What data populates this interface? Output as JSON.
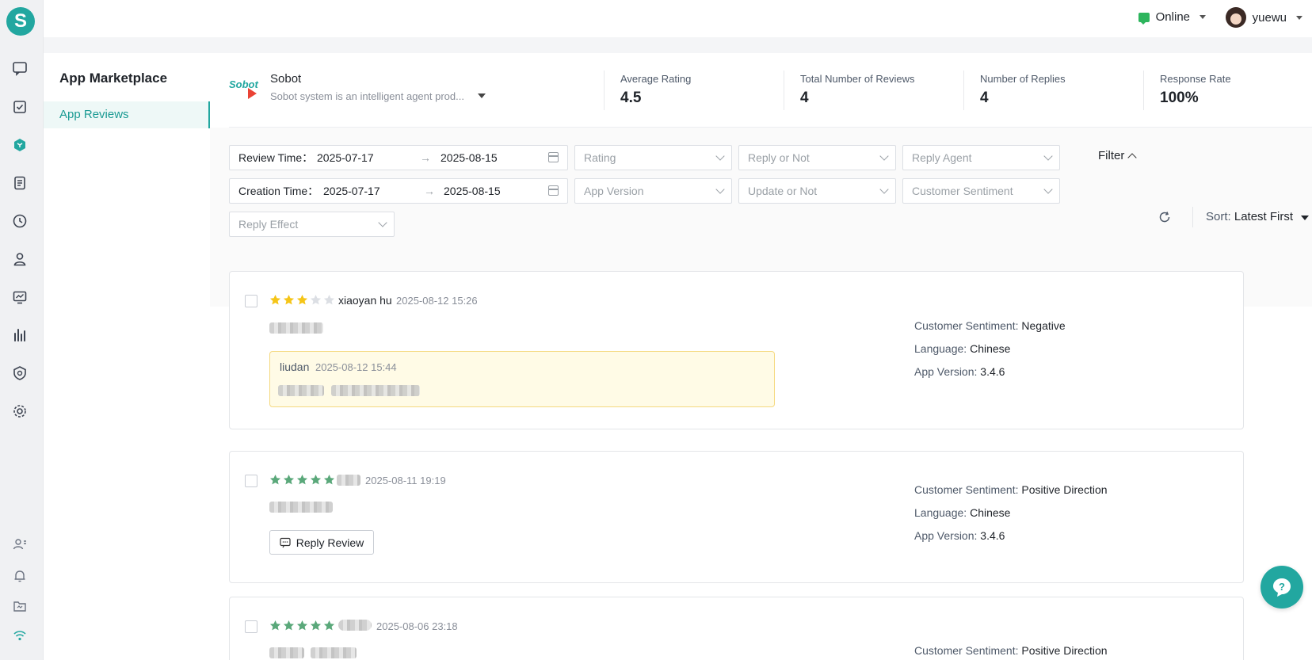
{
  "app_initial": "S",
  "topbar": {
    "status": "Online",
    "user": "yuewu"
  },
  "sidebar": {
    "title": "App Marketplace",
    "items": [
      {
        "label": "App Reviews"
      }
    ]
  },
  "app": {
    "logo_text": "Sobot",
    "name": "Sobot",
    "description": "Sobot system is an intelligent agent prod..."
  },
  "stats": [
    {
      "label": "Average Rating",
      "value": "4.5"
    },
    {
      "label": "Total Number of Reviews",
      "value": "4"
    },
    {
      "label": "Number of Replies",
      "value": "4"
    },
    {
      "label": "Response Rate",
      "value": "100%"
    }
  ],
  "filters": {
    "review_time": {
      "label": "Review Time：",
      "start": "2025-07-17",
      "end": "2025-08-15"
    },
    "creation_time": {
      "label": "Creation Time：",
      "start": "2025-07-17",
      "end": "2025-08-15"
    },
    "range_separator": "→",
    "rating": "Rating",
    "reply_or_not": "Reply or Not",
    "reply_agent": "Reply Agent",
    "app_version": "App Version",
    "update_or_not": "Update or Not",
    "customer_sentiment": "Customer Sentiment",
    "reply_effect": "Reply Effect",
    "filter_label": "Filter"
  },
  "sort": {
    "label": "Sort:",
    "value": "Latest First"
  },
  "meta_labels": {
    "sentiment": "Customer Sentiment:",
    "language": "Language:",
    "version": "App Version:"
  },
  "reviews": [
    {
      "rating": 3,
      "star_color": "#f5c518",
      "author": "xiaoyan hu",
      "time": "2025-08-12 15:26",
      "reply": {
        "agent": "liudan",
        "time": "2025-08-12 15:44"
      },
      "sentiment": "Negative",
      "language": "Chinese",
      "version": "3.4.6"
    },
    {
      "rating": 5,
      "star_color": "#5aa87a",
      "author": "",
      "time": "2025-08-11 19:19",
      "reply_button": "Reply Review",
      "sentiment": "Positive Direction",
      "language": "Chinese",
      "version": "3.4.6"
    },
    {
      "rating": 5,
      "star_color": "#5aa87a",
      "author": "",
      "time": "2025-08-06 23:18",
      "sentiment": "Positive Direction"
    }
  ],
  "colors": {
    "accent": "#22a7a0",
    "online": "#2db55d",
    "reply_bg": "#fffbe6"
  }
}
